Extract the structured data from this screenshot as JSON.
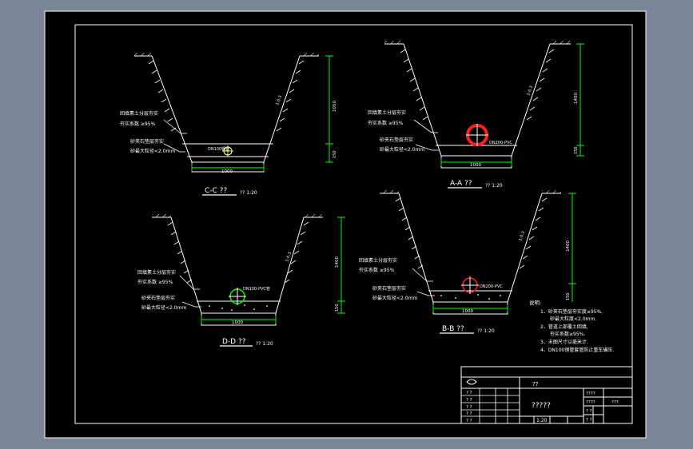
{
  "colors": {
    "background": "#7a8696",
    "paper": "#000000",
    "line": "#ffffff",
    "dimension": "#00ff00",
    "pipe_highlight": "#ff2020",
    "label": "#ffffff"
  },
  "sections": {
    "cc": {
      "title": "C-C ??",
      "scale": "?? 1:20",
      "label_backfill_1": "回填素土分层夯实",
      "label_backfill_2": "夯实系数 ≥95%",
      "label_sand_1": "砂夹石垫层夯实",
      "label_sand_2": "砂最大粒径<2.0mm",
      "pipe_label": "DN100钢管",
      "slope": "1:0.3",
      "dim_height_upper": "1050",
      "dim_height_lower": "150",
      "dim_width": "1000"
    },
    "aa": {
      "title": "A-A ??",
      "scale": "?? 1:20",
      "label_backfill_1": "回填素土分层夯实",
      "label_backfill_2": "夯实系数 ≥95%",
      "label_sand_1": "砂夹石垫层夯实",
      "label_sand_2": "砂最大粒径<2.0mm",
      "pipe_label": "DN200-PVC",
      "slope": "1:0.3",
      "dim_height_upper": "1400",
      "dim_height_lower": "150",
      "dim_width": "1000"
    },
    "dd": {
      "title": "D-D ??",
      "scale": "?? 1:20",
      "label_backfill_1": "回填素土分层夯实",
      "label_backfill_2": "夯实系数 ≥95%",
      "label_sand_1": "砂夹石垫层夯实",
      "label_sand_2": "砂最大粒径<2.0mm",
      "pipe_label": "DN100-PVC管",
      "slope": "1:0.3",
      "dim_height_upper": "1400",
      "dim_height_lower": "150",
      "dim_width": "1000"
    },
    "bb": {
      "title": "B-B ??",
      "scale": "?? 1:20",
      "label_backfill_1": "回填素土分层夯实",
      "label_backfill_2": "夯实系数 ≥95%",
      "label_sand_1": "砂夹石垫层夯实",
      "label_sand_2": "砂最大粒径<2.0mm",
      "pipe_label": "DN200-PVC",
      "slope": "1:0.3",
      "dim_height_upper": "1400",
      "dim_height_lower": "150",
      "dim_width": "1000"
    }
  },
  "notes": {
    "heading": "说明:",
    "line1": "1、砂夹石垫层夯实度≥95%,",
    "line1b": "砂最大粒度<2.0mm.",
    "line2": "2、管道上部覆土回填,",
    "line2b": "夯实系数≥95%.",
    "line3": "3、未图尺寸以毫米计.",
    "line4": "4、DN100钢管套管防止重车碾压."
  },
  "title_block": {
    "center_label": "??",
    "drawing_name": "?????",
    "scale_value": "1:20",
    "code_top": "????",
    "code_mid": "????",
    "code_right": "???",
    "row1": "? ?",
    "row2": "? ?",
    "row3": "? ?",
    "row4": "? ?",
    "row5": "? ?",
    "sheet_a": "? ?",
    "sheet_b": "? ?"
  }
}
